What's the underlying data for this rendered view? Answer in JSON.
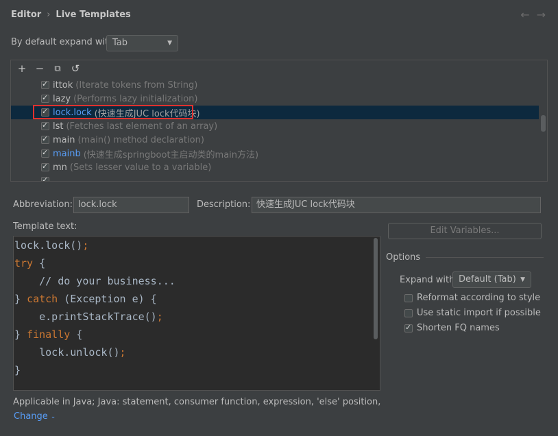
{
  "breadcrumb": {
    "parent": "Editor",
    "separator": "›",
    "current": "Live Templates"
  },
  "nav": {
    "back": "←",
    "forward": "→"
  },
  "expand_default": {
    "label": "By default expand with",
    "value": "Tab"
  },
  "toolbar": {
    "add": "+",
    "remove": "−",
    "copy": "⧉",
    "restore": "↺"
  },
  "templates": [
    {
      "abbr": "ittok",
      "desc": "(Iterate tokens from String)",
      "checked": true,
      "user": false
    },
    {
      "abbr": "lazy",
      "desc": "(Performs lazy initialization)",
      "checked": true,
      "user": false
    },
    {
      "abbr": "lock.lock",
      "desc": "(快速生成JUC lock代码块)",
      "checked": true,
      "user": true
    },
    {
      "abbr": "lst",
      "desc": "(Fetches last element of an array)",
      "checked": true,
      "user": false
    },
    {
      "abbr": "main",
      "desc": "(main() method declaration)",
      "checked": true,
      "user": false
    },
    {
      "abbr": "mainb",
      "desc": "(快速生成springboot主启动类的main方法)",
      "checked": true,
      "user": true
    },
    {
      "abbr": "mn",
      "desc": "(Sets lesser value to a variable)",
      "checked": true,
      "user": false
    }
  ],
  "abbreviation": {
    "label": "Abbreviation:",
    "value": "lock.lock"
  },
  "description": {
    "label": "Description:",
    "value": "快速生成JUC lock代码块"
  },
  "template_text": {
    "label": "Template text:",
    "lines": [
      "lock.lock();",
      "try {",
      "    // do your business...",
      "} catch (Exception e) {",
      "    e.printStackTrace();",
      "} finally {",
      "    lock.unlock();",
      "}"
    ]
  },
  "edit_variables": "Edit Variables...",
  "options": {
    "title": "Options",
    "expand_label": "Expand with",
    "expand_value": "Default (Tab)",
    "reformat": {
      "label": "Reformat according to style",
      "checked": false
    },
    "static_import": {
      "label": "Use static import if possible",
      "checked": false
    },
    "shorten_fq": {
      "label": "Shorten FQ names",
      "checked": true
    }
  },
  "applicable": "Applicable in Java; Java: statement, consumer function, expression, 'else' position, declarat...",
  "change": "Change"
}
